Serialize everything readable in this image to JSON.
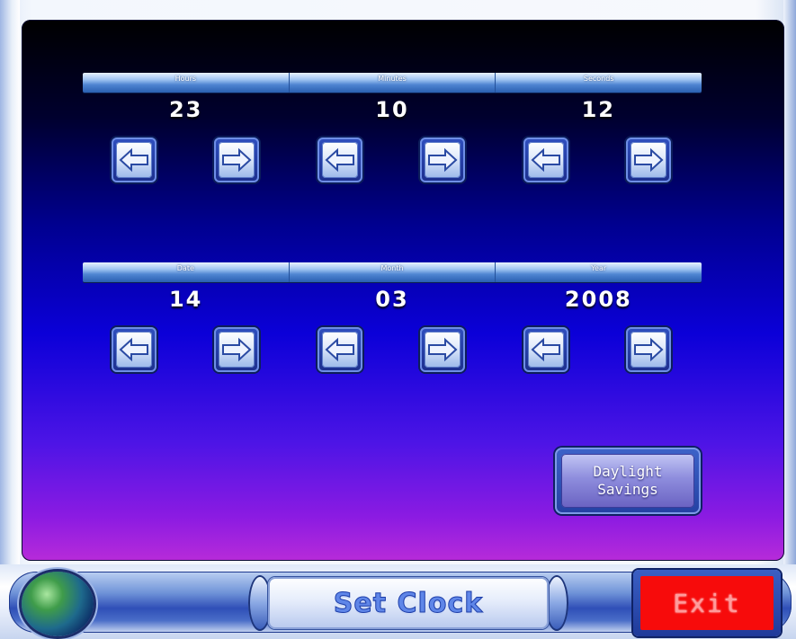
{
  "time": {
    "labels": [
      "Hours",
      "Minutes",
      "Seconds"
    ],
    "values": [
      "23",
      "10",
      "12"
    ]
  },
  "date": {
    "labels": [
      "Date",
      "Month",
      "Year"
    ],
    "values": [
      "14",
      "03",
      "2008"
    ]
  },
  "daylight_button_label": "Daylight\nSavings",
  "title": "Set Clock",
  "exit_label": "Exit",
  "icons": {
    "decrement": "left-arrow-icon",
    "increment": "right-arrow-icon",
    "globe": "globe-icon"
  },
  "colors": {
    "exit_red": "#f70b0b",
    "title_blue": "#5f86e8"
  }
}
